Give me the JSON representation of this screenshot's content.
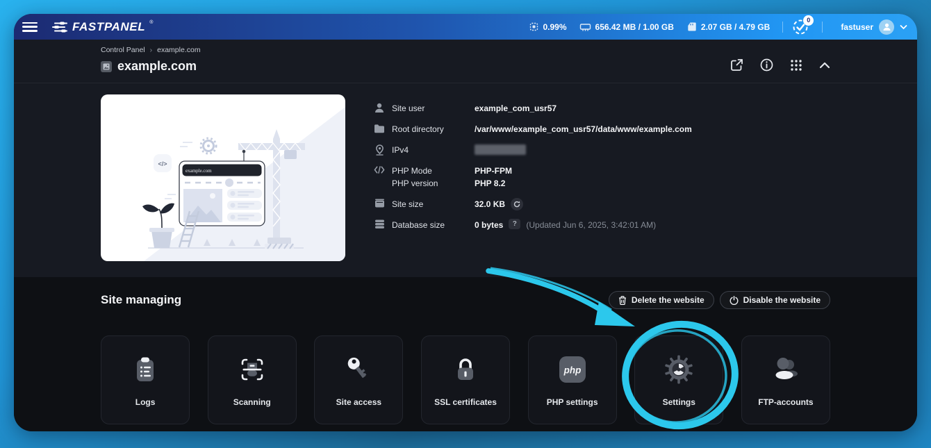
{
  "accent": {
    "cyan": "#2cc8ec",
    "topbar_left": "#1c2a72",
    "topbar_right": "#2196f3"
  },
  "topbar": {
    "logo_text": "FASTPANEL",
    "logo_reg": "®",
    "cpu_usage": "0.99%",
    "ram_usage": "656.42 MB / 1.00 GB",
    "disk_usage": "2.07 GB / 4.79 GB",
    "notifications_count": "0",
    "username": "fastuser"
  },
  "breadcrumb": {
    "root": "Control Panel",
    "separator": "›",
    "current": "example.com"
  },
  "page": {
    "title": "example.com"
  },
  "site_info": {
    "illustration_domain": "example.com",
    "rows": [
      {
        "label": "Site user",
        "value": "example_com_usr57"
      },
      {
        "label": "Root directory",
        "value": "/var/www/example_com_usr57/data/www/example.com"
      },
      {
        "label": "IPv4",
        "value": ""
      },
      {
        "label": "PHP Mode",
        "value": "PHP-FPM",
        "label2": "PHP version",
        "value2": "PHP 8.2"
      },
      {
        "label": "Site size",
        "value": "32.0 KB"
      },
      {
        "label": "Database size",
        "value": "0 bytes",
        "help": "?",
        "updated": "(Updated Jun 6, 2025, 3:42:01 AM)"
      }
    ]
  },
  "managing": {
    "heading": "Site managing",
    "delete_button": "Delete the website",
    "disable_button": "Disable the website",
    "tiles": [
      {
        "label": "Logs"
      },
      {
        "label": "Scanning"
      },
      {
        "label": "Site access"
      },
      {
        "label": "SSL certificates"
      },
      {
        "label": "PHP settings",
        "icon_text": "php"
      },
      {
        "label": "Settings"
      },
      {
        "label": "FTP-accounts"
      }
    ]
  }
}
